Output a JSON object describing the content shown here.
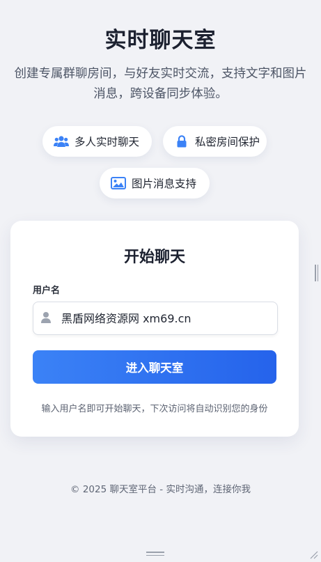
{
  "header": {
    "title": "实时聊天室",
    "subtitle": "创建专属群聊房间，与好友实时交流，支持文字和图片消息，跨设备同步体验。"
  },
  "features": [
    {
      "icon": "users-icon",
      "label": "多人实时聊天"
    },
    {
      "icon": "lock-icon",
      "label": "私密房间保护"
    },
    {
      "icon": "image-icon",
      "label": "图片消息支持"
    }
  ],
  "login": {
    "title": "开始聊天",
    "username_label": "用户名",
    "username_value": "黑盾网络资源网 xm69.cn",
    "submit_label": "进入聊天室",
    "hint": "输入用户名即可开始聊天，下次访问将自动识别您的身份"
  },
  "footer": {
    "text": "© 2025 聊天室平台 - 实时沟通，连接你我"
  },
  "colors": {
    "accent": "#3b82f6",
    "accent_dark": "#2563eb",
    "background": "#f1f2f6"
  }
}
